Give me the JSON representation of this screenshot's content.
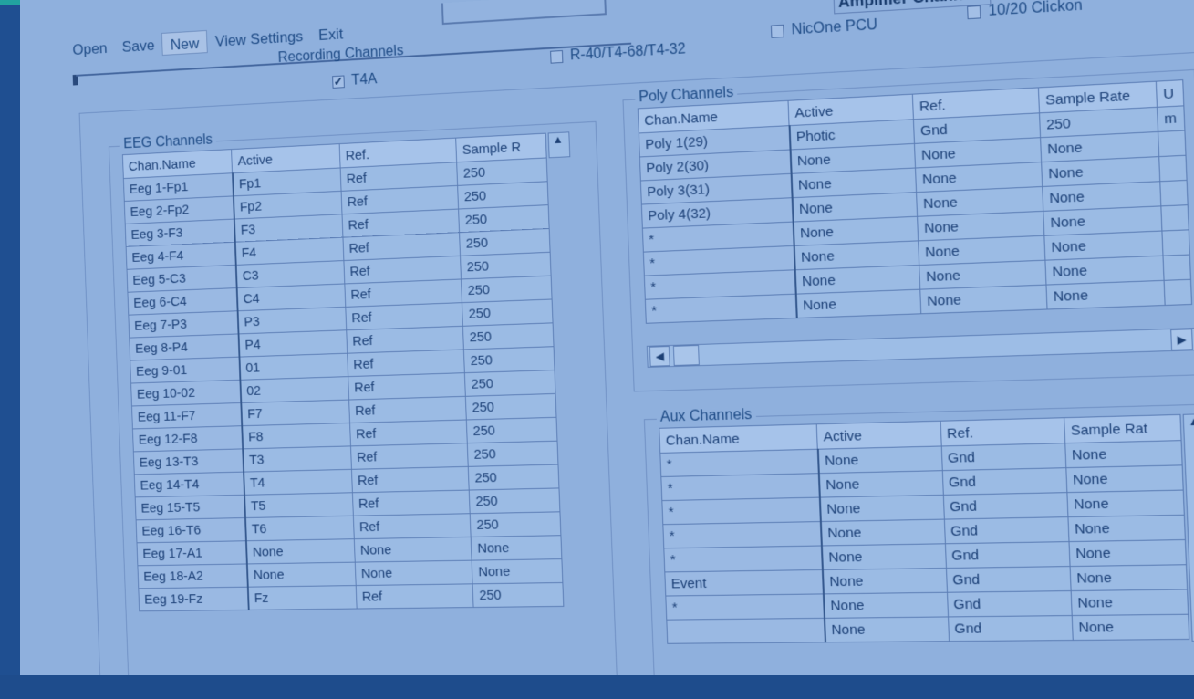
{
  "menu": {
    "open": "Open",
    "save": "Save",
    "new": "New",
    "view_settings": "View Settings",
    "exit": "Exit"
  },
  "amplifier_title": "Amplifier Channels",
  "recording_channels_label": "Recording Channels",
  "options": {
    "t4a": "T4A",
    "r40": "R-40/T4-68/T4-32",
    "nicone": "NicOne PCU",
    "clickon": "10/20 Clickon",
    "check_mark": "✓"
  },
  "eeg": {
    "title": "EEG Channels",
    "headers": [
      "Chan.Name",
      "Active",
      "Ref.",
      "Sample R"
    ],
    "rows": [
      [
        "Eeg 1-Fp1",
        "Fp1",
        "Ref",
        "250"
      ],
      [
        "Eeg 2-Fp2",
        "Fp2",
        "Ref",
        "250"
      ],
      [
        "Eeg 3-F3",
        "F3",
        "Ref",
        "250"
      ],
      [
        "Eeg 4-F4",
        "F4",
        "Ref",
        "250"
      ],
      [
        "Eeg 5-C3",
        "C3",
        "Ref",
        "250"
      ],
      [
        "Eeg 6-C4",
        "C4",
        "Ref",
        "250"
      ],
      [
        "Eeg 7-P3",
        "P3",
        "Ref",
        "250"
      ],
      [
        "Eeg 8-P4",
        "P4",
        "Ref",
        "250"
      ],
      [
        "Eeg 9-01",
        "01",
        "Ref",
        "250"
      ],
      [
        "Eeg 10-02",
        "02",
        "Ref",
        "250"
      ],
      [
        "Eeg 11-F7",
        "F7",
        "Ref",
        "250"
      ],
      [
        "Eeg 12-F8",
        "F8",
        "Ref",
        "250"
      ],
      [
        "Eeg 13-T3",
        "T3",
        "Ref",
        "250"
      ],
      [
        "Eeg 14-T4",
        "T4",
        "Ref",
        "250"
      ],
      [
        "Eeg 15-T5",
        "T5",
        "Ref",
        "250"
      ],
      [
        "Eeg 16-T6",
        "T6",
        "Ref",
        "250"
      ],
      [
        "Eeg 17-A1",
        "None",
        "None",
        "None"
      ],
      [
        "Eeg 18-A2",
        "None",
        "None",
        "None"
      ],
      [
        "Eeg 19-Fz",
        "Fz",
        "Ref",
        "250"
      ]
    ]
  },
  "poly": {
    "title": "Poly Channels",
    "headers": [
      "Chan.Name",
      "Active",
      "Ref.",
      "Sample Rate",
      "U"
    ],
    "rows": [
      [
        "Poly 1(29)",
        "Photic",
        "Gnd",
        "250",
        "m"
      ],
      [
        "Poly 2(30)",
        "None",
        "None",
        "None",
        ""
      ],
      [
        "Poly 3(31)",
        "None",
        "None",
        "None",
        ""
      ],
      [
        "Poly 4(32)",
        "None",
        "None",
        "None",
        ""
      ],
      [
        "*",
        "None",
        "None",
        "None",
        ""
      ],
      [
        "*",
        "None",
        "None",
        "None",
        ""
      ],
      [
        "*",
        "None",
        "None",
        "None",
        ""
      ],
      [
        "*",
        "None",
        "None",
        "None",
        ""
      ]
    ]
  },
  "aux": {
    "title": "Aux Channels",
    "headers": [
      "Chan.Name",
      "Active",
      "Ref.",
      "Sample Rat"
    ],
    "rows": [
      [
        "*",
        "None",
        "Gnd",
        "None"
      ],
      [
        "*",
        "None",
        "Gnd",
        "None"
      ],
      [
        "*",
        "None",
        "Gnd",
        "None"
      ],
      [
        "*",
        "None",
        "Gnd",
        "None"
      ],
      [
        "*",
        "None",
        "Gnd",
        "None"
      ],
      [
        "Event",
        "None",
        "Gnd",
        "None"
      ],
      [
        "*",
        "None",
        "Gnd",
        "None"
      ],
      [
        "",
        "None",
        "Gnd",
        "None"
      ]
    ]
  },
  "scroll": {
    "up": "▲",
    "down": "▼",
    "left": "◀",
    "right": "▶"
  }
}
